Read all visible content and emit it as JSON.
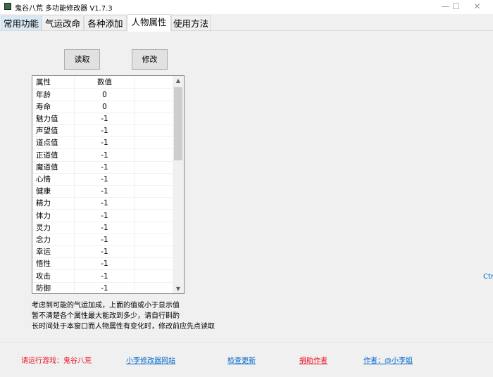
{
  "window": {
    "title": "鬼谷八荒 多功能修改器  V1.7.3",
    "minimize": "—",
    "maximize": "☐",
    "close": "✕"
  },
  "tabs": [
    "常用功能",
    "气运改命",
    "各种添加",
    "人物属性",
    "使用方法"
  ],
  "buttons": {
    "read": "读取",
    "modify": "修改"
  },
  "table": {
    "headers": [
      "属性",
      "数值"
    ],
    "rows": [
      [
        "年龄",
        "0"
      ],
      [
        "寿命",
        "0"
      ],
      [
        "魅力值",
        "-1"
      ],
      [
        "声望值",
        "-1"
      ],
      [
        "道点值",
        "-1"
      ],
      [
        "正道值",
        "-1"
      ],
      [
        "魔道值",
        "-1"
      ],
      [
        "心情",
        "-1"
      ],
      [
        "健康",
        "-1"
      ],
      [
        "精力",
        "-1"
      ],
      [
        "体力",
        "-1"
      ],
      [
        "灵力",
        "-1"
      ],
      [
        "念力",
        "-1"
      ],
      [
        "幸运",
        "-1"
      ],
      [
        "悟性",
        "-1"
      ],
      [
        "攻击",
        "-1"
      ],
      [
        "防御",
        "-1"
      ]
    ]
  },
  "notes": [
    "考虑到可能的气运加成，上面的值或小于显示值",
    "暂不清楚各个属性最大能改到多少，请自行斟酌",
    "长时间处于本窗口而人物属性有变化时，修改前应先点读取"
  ],
  "edge_text": "Ctr",
  "footer": {
    "status": "请运行游戏：鬼谷八荒",
    "site": "小李修改器网站",
    "update": "检查更新",
    "donate": "捐助作者",
    "author": "作者：@小李姐"
  },
  "colors": {
    "red": "#e81123",
    "link": "#0066cc"
  }
}
